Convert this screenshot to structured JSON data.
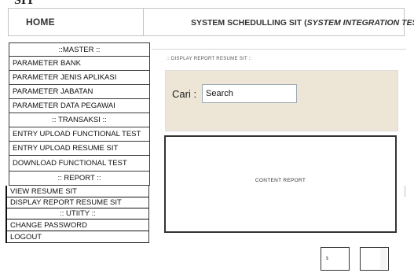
{
  "header": {
    "home_label": "HOME",
    "title_main": "SYSTEM SCHEDULLING SIT (",
    "title_italic": "SYSTEM INTEGRATION TEST",
    "title_end": ")",
    "top_fragment": "SIT"
  },
  "sidebar": {
    "items": [
      {
        "label": "::MASTER ::"
      },
      {
        "label": "PARAMETER BANK"
      },
      {
        "label": "PARAMETER JENIS APLIKASI"
      },
      {
        "label": "PARAMETER JABATAN"
      },
      {
        "label": "PARAMETER DATA PEGAWAI"
      },
      {
        "label": ":: TRANSAKSI ::"
      },
      {
        "label": "ENTRY UPLOAD FUNCTIONAL TEST"
      },
      {
        "label": "ENTRY UPLOAD RESUME SIT"
      },
      {
        "label": "DOWNLOAD FUNCTIONAL TEST"
      },
      {
        "label": ":: REPORT ::"
      },
      {
        "label": "VIEW RESUME SIT"
      },
      {
        "label": "DISPLAY REPORT RESUME SIT"
      },
      {
        "label": ":: UTIITY ::"
      },
      {
        "label": "CHANGE PASSWORD"
      },
      {
        "label": "LOGOUT"
      }
    ]
  },
  "main": {
    "panel_title": ":: DISPLAY REPORT RESUME SIT ::",
    "search_label": "Cari  :",
    "search_value": "Search",
    "content_label": "CONTENT REPORT",
    "button_1_label": "$"
  },
  "colors": {
    "search_area_bg": "#ede6d6",
    "border": "#333333"
  }
}
